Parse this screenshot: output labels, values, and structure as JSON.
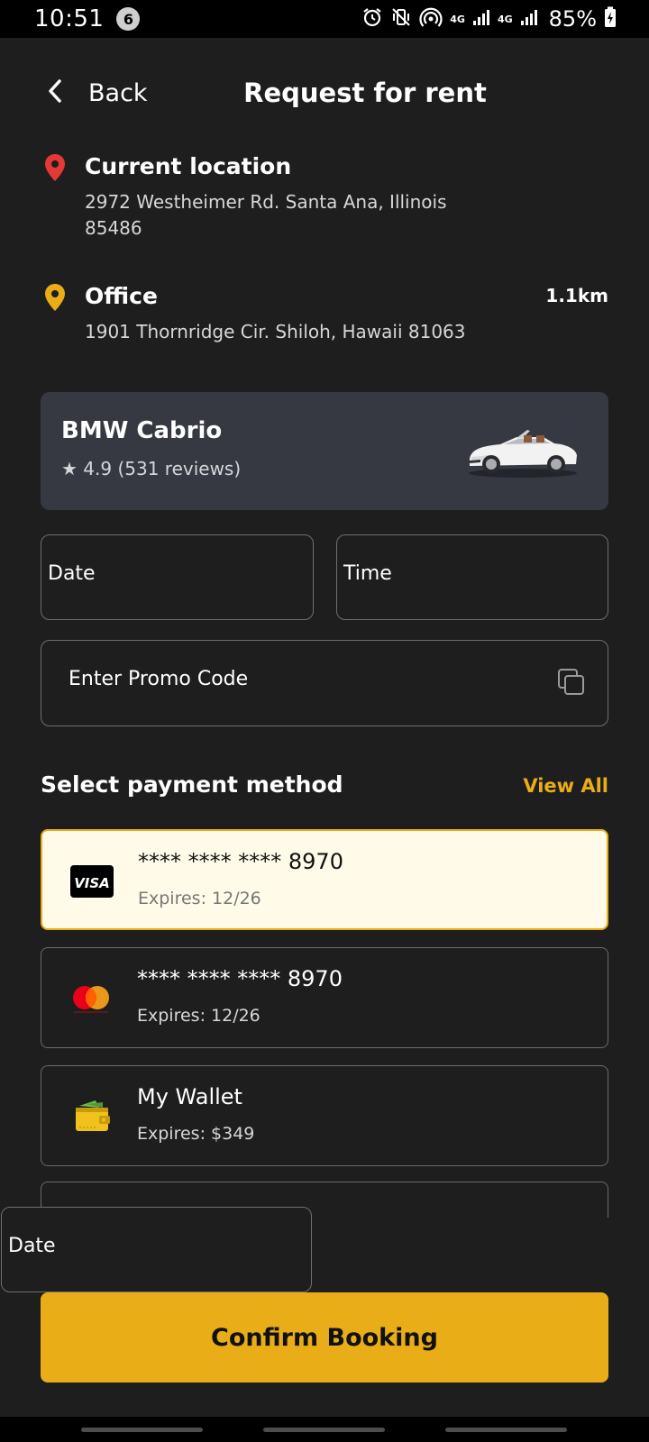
{
  "status_bar": {
    "time": "10:51",
    "notification_count": "6",
    "network_a": "4G",
    "network_b": "4G",
    "battery": "85%"
  },
  "header": {
    "back_label": "Back",
    "title": "Request for rent"
  },
  "pickup": {
    "title": "Current location",
    "address": "2972 Westheimer Rd. Santa Ana, Illinois 85486",
    "pin_color": "#e53935"
  },
  "dropoff": {
    "title": "Office",
    "address": "1901 Thornridge Cir. Shiloh, Hawaii 81063",
    "distance": "1.1km",
    "pin_color": "#e9ae17"
  },
  "car": {
    "name": "BMW Cabrio",
    "rating": "★ 4.9 (531 reviews)"
  },
  "form": {
    "date_label": "Date",
    "time_label": "Time",
    "promo_placeholder": "Enter Promo Code"
  },
  "payment": {
    "heading": "Select payment method",
    "view_all": "View All",
    "methods": [
      {
        "brand": "visa",
        "brand_text": "VISA",
        "number": "**** **** **** 8970",
        "expiry": "Expires: 12/26",
        "selected": true
      },
      {
        "brand": "mastercard",
        "number": "**** **** **** 8970",
        "expiry": "Expires: 12/26",
        "selected": false
      },
      {
        "brand": "wallet",
        "number": "My Wallet",
        "expiry": "Expires: $349",
        "selected": false
      }
    ]
  },
  "overlay": {
    "date_label": "Date"
  },
  "confirm_label": "Confirm Booking",
  "colors": {
    "accent": "#e9ae17",
    "background": "#1e1e1e",
    "card": "#363941",
    "selected_card": "#fffbe8"
  }
}
